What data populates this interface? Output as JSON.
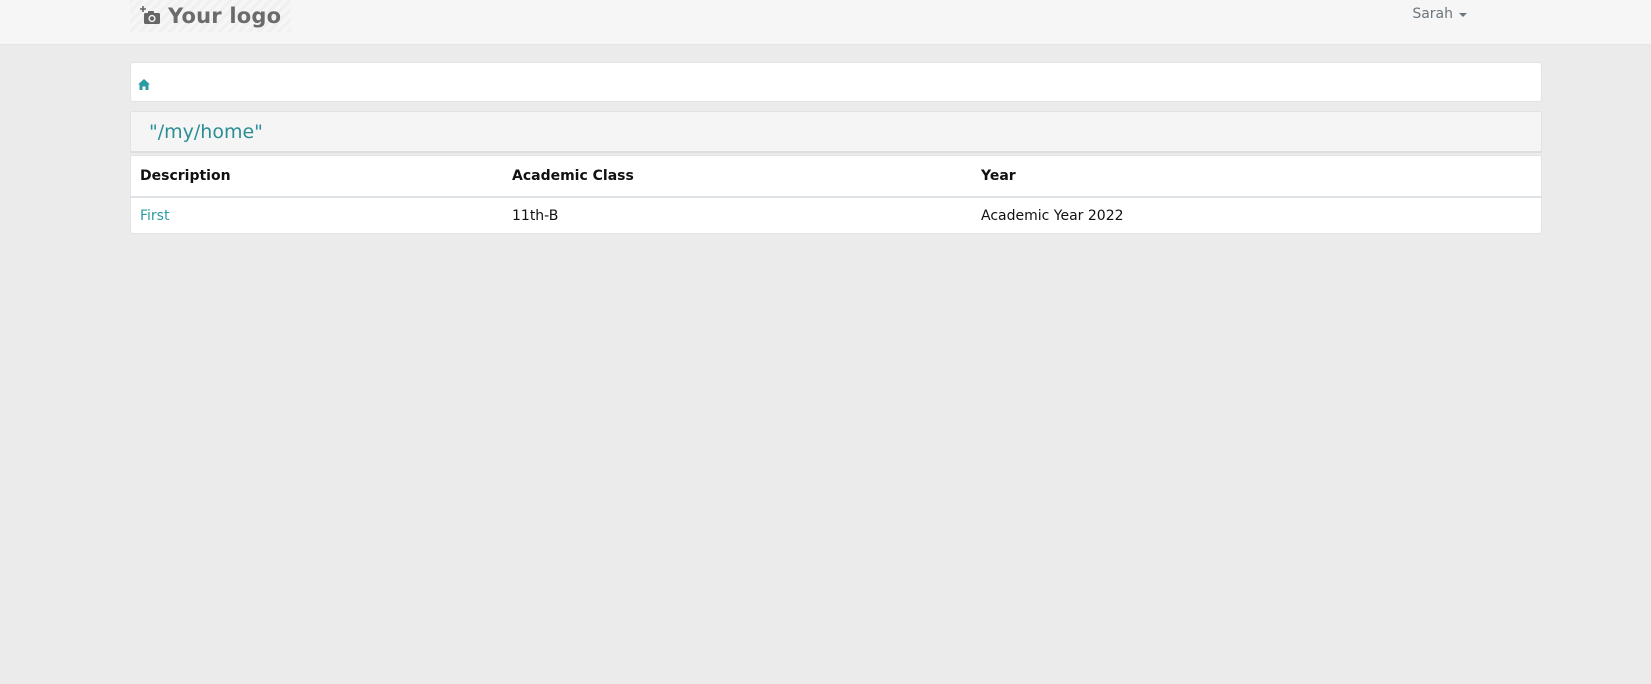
{
  "header": {
    "logo_text": "Your logo",
    "logo_icon": "camera-add-icon",
    "user_name": "Sarah",
    "user_caret_icon": "caret-down-icon"
  },
  "breadcrumb": {
    "home_icon": "home-icon"
  },
  "panel": {
    "title": "\"/my/home\""
  },
  "table": {
    "columns": [
      "Description",
      "Academic Class",
      "Year"
    ],
    "rows": [
      [
        "First",
        "11th-B",
        "Academic Year 2022"
      ]
    ]
  },
  "colors": {
    "accent": "#2b8e95",
    "link": "#2b9ba3",
    "page_bg": "#ebebeb"
  }
}
